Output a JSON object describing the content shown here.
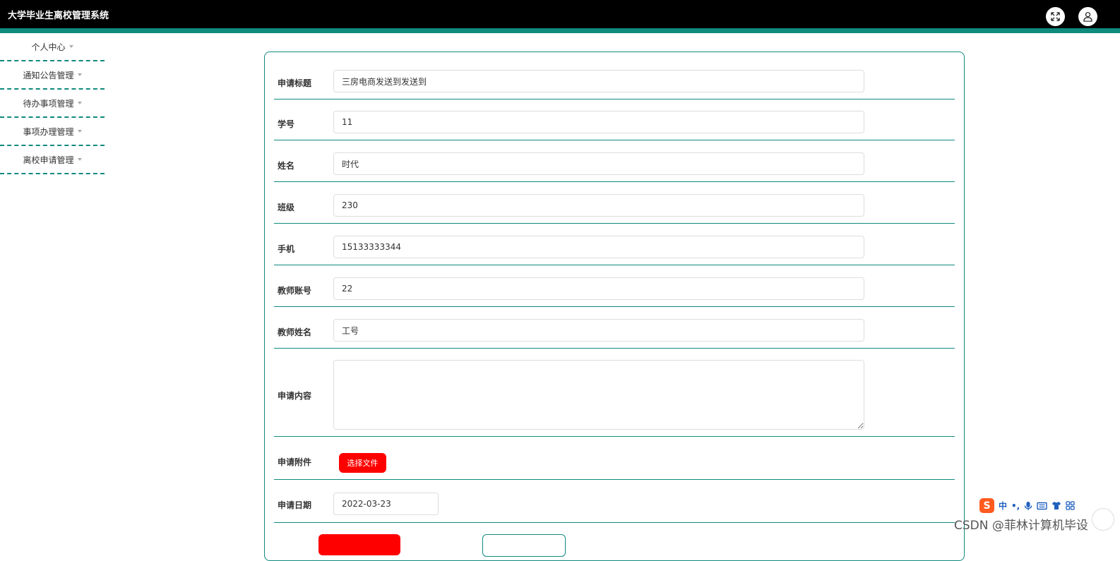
{
  "header": {
    "title": "大学毕业生离校管理系统",
    "fullscreen_icon": "expand-icon",
    "user_icon": "user-icon"
  },
  "sidebar": {
    "items": [
      {
        "label": "个人中心"
      },
      {
        "label": "通知公告管理"
      },
      {
        "label": "待办事项管理"
      },
      {
        "label": "事项办理管理"
      },
      {
        "label": "离校申请管理"
      }
    ]
  },
  "form": {
    "title_label": "申请标题",
    "title_value": "三房电商发送到发送到",
    "student_id_label": "学号",
    "student_id_value": "11",
    "name_label": "姓名",
    "name_value": "时代",
    "class_label": "班级",
    "class_value": "230",
    "phone_label": "手机",
    "phone_value": "15133333344",
    "teacher_account_label": "教师账号",
    "teacher_account_value": "22",
    "teacher_name_label": "教师姓名",
    "teacher_name_value": "工号",
    "content_label": "申请内容",
    "content_value": "",
    "attachment_label": "申请附件",
    "attachment_button": "选择文件",
    "date_label": "申请日期",
    "date_value": "2022-03-23"
  },
  "ime": {
    "logo": "S",
    "mode": "中"
  },
  "watermark": "CSDN @菲林计算机毕设",
  "colors": {
    "accent": "#0f8a7d",
    "primary_button": "#ff0000",
    "header_bg": "#000000"
  }
}
